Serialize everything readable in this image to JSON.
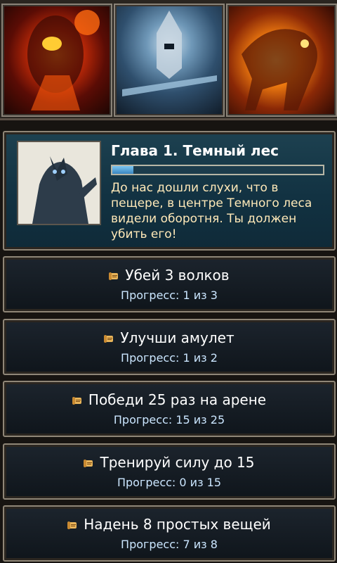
{
  "banner": {
    "heroes": [
      {
        "icon": "fire-golem-portrait"
      },
      {
        "icon": "armored-knight-portrait"
      },
      {
        "icon": "fire-horse-portrait"
      }
    ]
  },
  "chapter": {
    "title": "Глава 1. Темный лес",
    "progress_fraction": 0.1,
    "description": "До нас дошли слухи, что в пещере, в центре Темного леса видели оборотня. Ты должен убить его!",
    "portrait_icon": "werewolf-portrait"
  },
  "quests": [
    {
      "title": "Убей 3 волков",
      "progress": "Прогресс: 1 из 3"
    },
    {
      "title": "Улучши амулет",
      "progress": "Прогресс: 1 из 2"
    },
    {
      "title": "Победи 25 раз на арене",
      "progress": "Прогресс: 15 из 25"
    },
    {
      "title": "Тренируй силу до 15",
      "progress": "Прогресс: 0 из 15"
    },
    {
      "title": "Надень 8 простых вещей",
      "progress": "Прогресс: 7 из 8"
    }
  ],
  "colors": {
    "title_text": "#ffffff",
    "description_text": "#ffe9b8",
    "progress_text": "#cbe6ff",
    "progress_fill": "#5aa6dc"
  }
}
